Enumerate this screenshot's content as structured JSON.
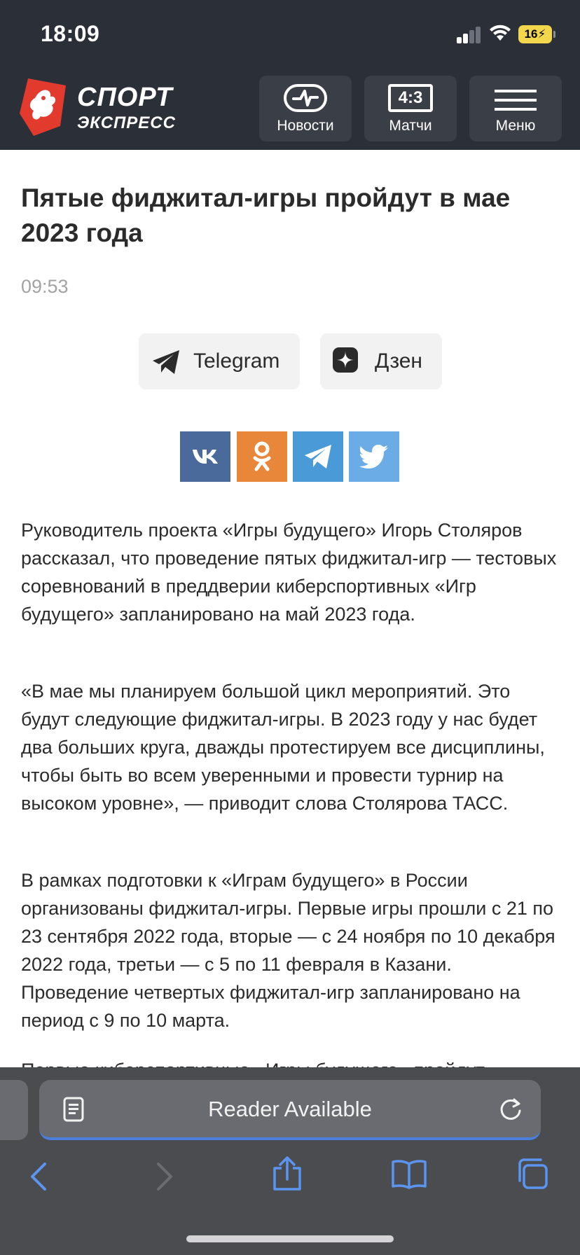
{
  "status_bar": {
    "time": "18:09",
    "battery": "16"
  },
  "site": {
    "logo_line1": "СПОРТ",
    "logo_line2": "ЭКСПРЕСС",
    "nav": [
      {
        "label": "Новости",
        "icon": "news-pulse-icon"
      },
      {
        "label": "Матчи",
        "icon": "scoreboard-icon",
        "score": "4:3"
      },
      {
        "label": "Меню",
        "icon": "hamburger-menu-icon"
      }
    ]
  },
  "article": {
    "title": "Пятые фиджитал-игры пройдут в мае 2023 года",
    "time": "09:53",
    "subscribe": [
      {
        "label": "Telegram",
        "icon": "telegram-icon"
      },
      {
        "label": "Дзен",
        "icon": "dzen-icon"
      }
    ],
    "share": [
      {
        "network": "vk",
        "icon": "vk-icon",
        "color": "#4a6a9c"
      },
      {
        "network": "ok",
        "icon": "odnoklassniki-icon",
        "color": "#e8873a"
      },
      {
        "network": "telegram",
        "icon": "telegram-icon",
        "color": "#4a9ad8"
      },
      {
        "network": "twitter",
        "icon": "twitter-icon",
        "color": "#6cace6"
      }
    ],
    "paragraphs": [
      "Руководитель проекта «Игры будущего» Игорь Столяров рассказал, что проведение пятых фиджитал-игр — тестовых соревнований в преддверии киберспортивных «Игр будущего» запланировано на май 2023 года.",
      "«В мае мы планируем большой цикл мероприятий. Это будут следующие фиджитал-игры. В 2023 году у нас будет два больших круга, дважды протестируем все дисциплины, чтобы быть во всем уверенными и провести турнир на высоком уровне», — приводит слова Столярова ТАСС.",
      "В рамках подготовки к «Играм будущего» в России организованы фиджитал-игры. Первые игры прошли с 21 по 23 сентября 2022 года, вторые — с 24 ноября по 10 декабря 2022 года, третьи — с 5 по 11 февраля в Казани. Проведение четвертых фиджитал-игр запланировано на период с 9 по 10 марта.",
      "Первые киберспортивные «Игры будущего» пройдут"
    ]
  },
  "browser": {
    "url_bar_text": "Reader Available",
    "toolbar": [
      "back-icon",
      "forward-icon",
      "share-icon",
      "bookmarks-icon",
      "tabs-icon"
    ]
  }
}
